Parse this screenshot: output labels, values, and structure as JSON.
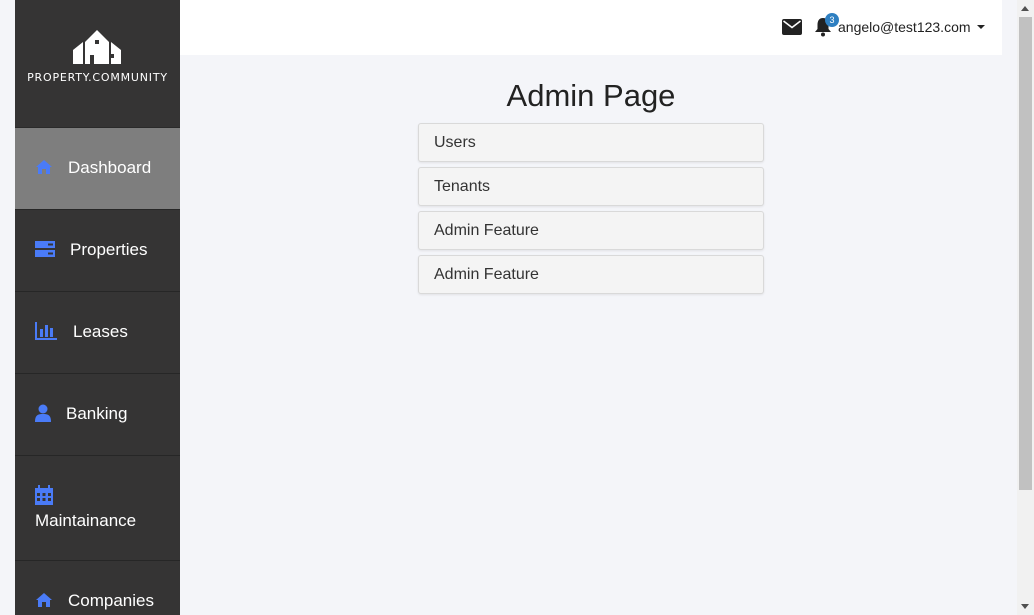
{
  "brand": {
    "name": "PROPERTY.COMMUNITY",
    "logo_icon": "house-logo-icon"
  },
  "colors": {
    "sidebar_bg": "#353434",
    "sidebar_active_bg": "#7e7e7e",
    "icon_accent": "#4a7bf7",
    "badge": "#2e7fc1"
  },
  "sidebar": {
    "items": [
      {
        "label": "Dashboard",
        "icon": "home-icon",
        "active": true
      },
      {
        "label": "Properties",
        "icon": "server-icon",
        "active": false
      },
      {
        "label": "Leases",
        "icon": "bar-chart-icon",
        "active": false
      },
      {
        "label": "Banking",
        "icon": "user-icon",
        "active": false
      },
      {
        "label": "Maintainance",
        "icon": "calendar-icon",
        "active": false
      },
      {
        "label": "Companies",
        "icon": "home-icon",
        "active": false
      }
    ]
  },
  "header": {
    "mail_icon": "envelope-icon",
    "notifications_icon": "bell-icon",
    "notification_count": "3",
    "user_email": "angelo@test123.com"
  },
  "main": {
    "title": "Admin Page",
    "admin_items": [
      {
        "label": "Users"
      },
      {
        "label": "Tenants"
      },
      {
        "label": "Admin Feature"
      },
      {
        "label": "Admin Feature"
      }
    ]
  }
}
